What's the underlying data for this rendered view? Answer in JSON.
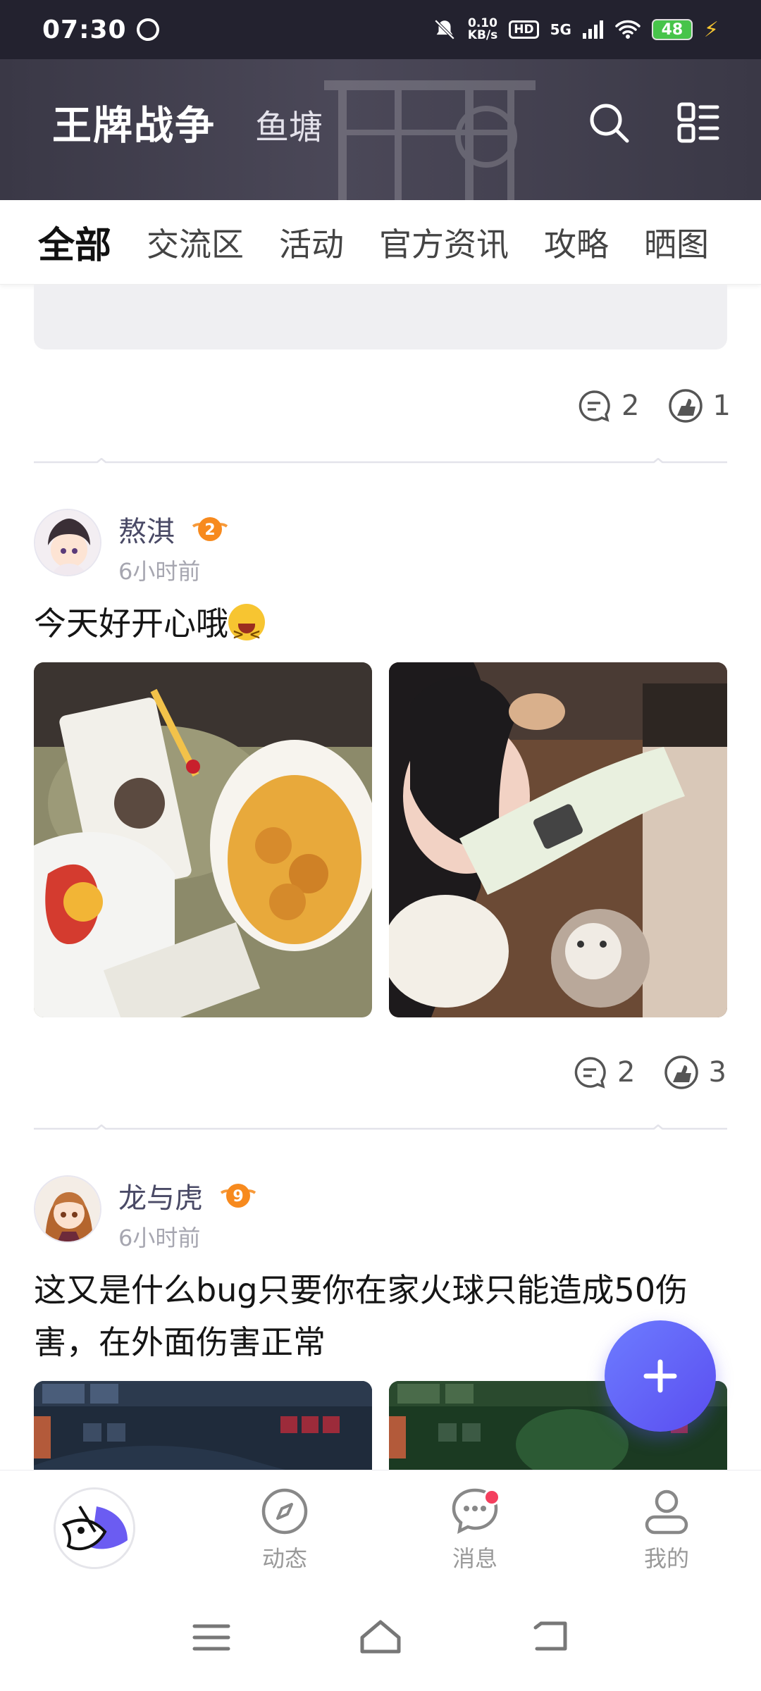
{
  "status_bar": {
    "time": "07:30",
    "net_speed_value": "0.10",
    "net_speed_unit": "KB/s",
    "hd": "HD",
    "network": "5G",
    "battery": "48"
  },
  "header": {
    "title": "王牌战争",
    "subtitle": "鱼塘"
  },
  "tabs": [
    {
      "label": "全部",
      "active": true
    },
    {
      "label": "交流区",
      "active": false
    },
    {
      "label": "活动",
      "active": false
    },
    {
      "label": "官方资讯",
      "active": false
    },
    {
      "label": "攻略",
      "active": false
    },
    {
      "label": "晒图",
      "active": false
    }
  ],
  "prev_post": {
    "comments": "2",
    "likes": "1"
  },
  "posts": [
    {
      "username": "熬淇",
      "level": "2",
      "time": "6小时前",
      "text": "今天好开心哦",
      "comments": "2",
      "likes": "3"
    },
    {
      "username": "龙与虎",
      "level": "9",
      "time": "6小时前",
      "text": "这又是什么bug只要你在家火球只能造成50伤害，在外面伤害正常"
    }
  ],
  "bottom_nav": [
    {
      "label": "",
      "icon": "app-logo-icon"
    },
    {
      "label": "动态",
      "icon": "compass-icon"
    },
    {
      "label": "消息",
      "icon": "chat-bubble-icon"
    },
    {
      "label": "我的",
      "icon": "person-icon"
    }
  ]
}
